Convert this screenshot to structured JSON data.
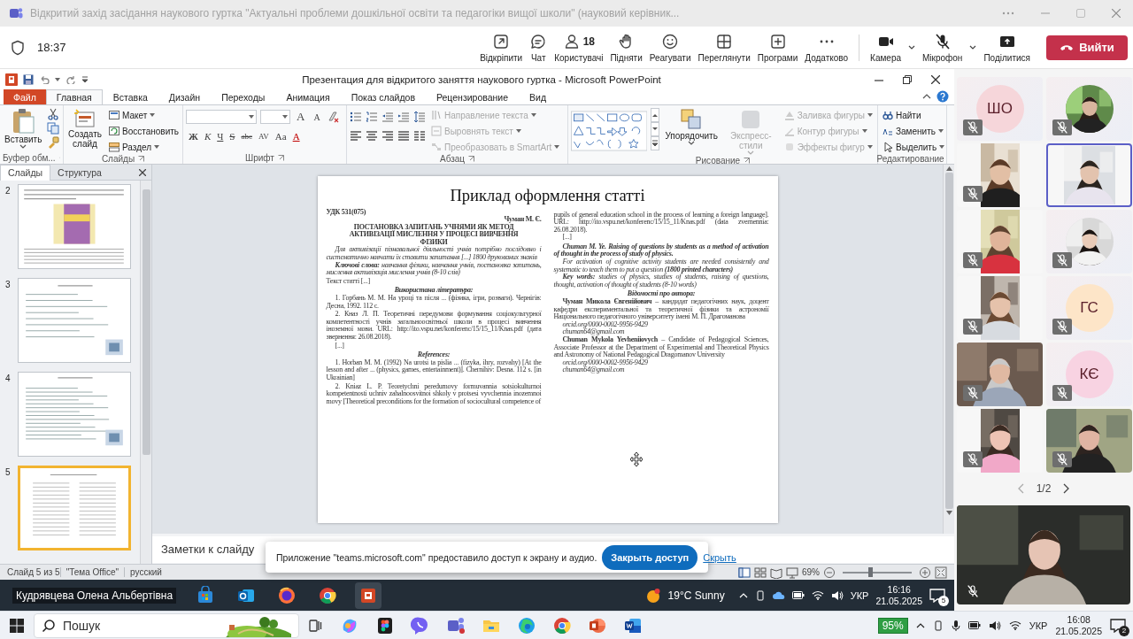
{
  "teams_window": {
    "title": "Відкритий захід засідання наукового гуртка \"Актуальні проблеми дошкільної освіти та педагогіки вищої школи\" (науковий керівник..."
  },
  "meeting_bar": {
    "elapsed": "18:37",
    "participants_count": "18",
    "buttons": [
      {
        "label": "Відкріпити"
      },
      {
        "label": "Чат"
      },
      {
        "label": "Користувачі"
      },
      {
        "label": "Підняти"
      },
      {
        "label": "Реагувати"
      },
      {
        "label": "Переглянути"
      },
      {
        "label": "Програми"
      },
      {
        "label": "Додатково"
      }
    ],
    "devices": [
      {
        "label": "Камера",
        "on": true
      },
      {
        "label": "Мікрофон",
        "on": false
      }
    ],
    "share": "Поділитися",
    "leave": "Вийти"
  },
  "powerpoint": {
    "title": "Презентация для відкритого заняття наукового гуртка  -  Microsoft PowerPoint",
    "file_tab": "Файл",
    "tabs": [
      {
        "label": "Главная",
        "selected": true
      },
      {
        "label": "Вставка",
        "selected": false
      },
      {
        "label": "Дизайн",
        "selected": false
      },
      {
        "label": "Переходы",
        "selected": false
      },
      {
        "label": "Анимация",
        "selected": false
      },
      {
        "label": "Показ слайдов",
        "selected": false
      },
      {
        "label": "Рецензирование",
        "selected": false
      },
      {
        "label": "Вид",
        "selected": false
      }
    ],
    "ribbon": {
      "clipboard": {
        "paste": "Вставить",
        "label": "Буфер обм..."
      },
      "slides": {
        "new_slide": "Создать слайд",
        "items": [
          "Макет",
          "Восстановить",
          "Раздел"
        ],
        "label": "Слайды"
      },
      "font": {
        "grow": "A",
        "shrink": "A",
        "format_buttons": [
          "Ж",
          "К",
          "Ч",
          "S",
          "abc",
          "AV",
          "Aa",
          "A"
        ],
        "label": "Шрифт"
      },
      "paragraph": {
        "commands": [
          {
            "label": "Направление текста",
            "disabled": true
          },
          {
            "label": "Выровнять текст",
            "disabled": true
          },
          {
            "label": "Преобразовать в SmartArt",
            "disabled": true
          }
        ],
        "label": "Абзац"
      },
      "drawing": {
        "arrange": "Упорядочить",
        "quick_styles": {
          "label": "Экспресс-стили",
          "disabled": true
        },
        "commands": [
          {
            "label": "Заливка фигуры",
            "disabled": true
          },
          {
            "label": "Контур фигуры",
            "disabled": true
          },
          {
            "label": "Эффекты фигур",
            "disabled": true
          }
        ],
        "label": "Рисование"
      },
      "editing": {
        "commands": [
          {
            "label": "Найти",
            "disabled": false
          },
          {
            "label": "Заменить",
            "disabled": false
          },
          {
            "label": "Выделить",
            "disabled": false
          }
        ],
        "label": "Редактирование"
      }
    },
    "panel": {
      "tabs": [
        {
          "label": "Слайды",
          "selected": true
        },
        {
          "label": "Структура",
          "selected": false
        }
      ],
      "thumbnails": [
        {
          "number": "2",
          "selected": false
        },
        {
          "number": "3",
          "selected": false
        },
        {
          "number": "4",
          "selected": false
        },
        {
          "number": "5",
          "selected": true
        }
      ]
    },
    "slide": {
      "title": "Приклад оформлення статті",
      "columns": [
        [
          {
            "kind": "udc",
            "text": "УДК 531(075)"
          },
          {
            "kind": "author",
            "text": "Чуман М. Є."
          },
          {
            "kind": "title",
            "text": "ПОСТАНОВКА ЗАПИТАНЬ УЧНЯМИ ЯК МЕТОД АКТИВІЗАЦІЇ МИСЛЕННЯ У ПРОЦЕСІ ВИВЧЕННЯ ФІЗИКИ"
          },
          {
            "kind": "abstract",
            "text": "Для активізації пізнавальної діяльності учнів потрібно послідовно і систематично навчати їх ставити запитання [...] 1800 друкованих знаків"
          },
          {
            "kind": "abstract",
            "text": "**Ключові слова:** навчання фізики, навчання учнів, постановка запитань, мислення активізація мислення учнів (8-10 слів)"
          },
          {
            "kind": "text",
            "text": "Текст статті [...]"
          },
          {
            "kind": "heading",
            "text": "Використана література:"
          },
          {
            "kind": "ref",
            "text": "1. Горбань М. М. На уроці та після ... (фізика, ігри, розваги). Чернігів: Десна, 1992. 112 с."
          },
          {
            "kind": "ref",
            "text": "2. Кназ Л. П. Теоретичні передумови формування соціокультурної компетентності учнів загальноосвітньої школи в процесі вивчення іноземної мови. URL: http://ito.vspu.net/konferenc/15/15_11/Knas.pdf (дата звернення: 26.08.2018)."
          },
          {
            "kind": "ref",
            "text": "[...]"
          },
          {
            "kind": "heading",
            "text": "References:"
          },
          {
            "kind": "ref",
            "text": "1. Horban M. M. (1992) Na urotsi ta pislia ... (fizyka, ihry, rozvahy) [At the lesson and after ... (physics, games, entertainment)]. Chernihiv: Desna. 112 s. [in Ukrainian]"
          },
          {
            "kind": "ref",
            "text": "2. Kniaz L. P. Teoretychni peredumovy formuvannia sotsiokulturnoi kompetentnosti uchniv zahalnoosvitnoi shkoly v protsesi vyvchennia inozemnoi movy [Theoretical preconditions for the formation of sociocultural competence of"
          }
        ],
        [
          {
            "kind": "text",
            "text": "pupils of general education school in the process of learning a foreign language]. URL: http://ito.vspu.net/konferenc/15/15_11/Knas.pdf (data zvernennia: 26.08.2018)."
          },
          {
            "kind": "ref",
            "text": "[...]"
          },
          {
            "kind": "abstract-title",
            "text": "Chuman M. Ye. Raising of questions by students as a method of activation of thought in the process of study of physics."
          },
          {
            "kind": "abstract",
            "text": "For activation of cognitive activity students are needed consistently and systematic to teach them to put a question **(1800 printed characters)**"
          },
          {
            "kind": "abstract",
            "text": "**Key words:** studies of physics, studies of students, raising of questions, thought, activation of thought of students (8-10 words)"
          },
          {
            "kind": "heading",
            "text": "Відомості про автора:"
          },
          {
            "kind": "bio",
            "text": "**Чуман Микола Євгенійович** – кандидат педагогічних наук, доцент кафедри експериментальної та теоретичної фізики та астрономії Національного педагогічного університету імені М. П. Драгоманова"
          },
          {
            "kind": "contact",
            "text": "orcid.org/0000-0002-9956-9429"
          },
          {
            "kind": "contact",
            "text": "chuman64@gmail.com"
          },
          {
            "kind": "bio",
            "text": "**Chuman Mykola Yevheniiovych** – Candidate of Pedagogical Sciences, Associate Professor at the Department of Experimental and Theoretical Physics and Astronomy of National Pedagogical Dragomanov University"
          },
          {
            "kind": "contact",
            "text": "orcid.org/0000-0002-9956-9429"
          },
          {
            "kind": "contact",
            "text": "chuman64@gmail.com"
          }
        ]
      ]
    },
    "notes": {
      "placeholder": "Заметки к слайду"
    },
    "status_bar": {
      "slide": "Слайд 5 из 5",
      "theme": "\"Тема Office\"",
      "language": "русский",
      "zoom": "69%",
      "zoom_slider": {
        "level": 0.4
      }
    }
  },
  "share_banner": {
    "text": "Приложение \"teams.microsoft.com\" предоставило доступ к экрану и аудио.",
    "stop": "Закрыть доступ",
    "hide": "Скрыть"
  },
  "shared_taskbar": {
    "presenter": "Кудрявцева Олена Альбертівна",
    "weather": "19°C Sunny",
    "language": "УКР",
    "time": "16:16",
    "date": "21.05.2025",
    "notifications": "5"
  },
  "gallery": {
    "participants": [
      {
        "kind": "initials",
        "initials": "ШО",
        "color": "#f6d6da",
        "muted": true,
        "speaking": false
      },
      {
        "kind": "avatar",
        "muted": true,
        "speaking": false
      },
      {
        "kind": "video-portrait",
        "muted": true,
        "speaking": false
      },
      {
        "kind": "video-portrait",
        "muted": false,
        "speaking": true
      },
      {
        "kind": "video-portrait",
        "muted": true,
        "speaking": false
      },
      {
        "kind": "avatar",
        "muted": true,
        "speaking": false
      },
      {
        "kind": "video-portrait",
        "muted": true,
        "speaking": false
      },
      {
        "kind": "initials",
        "initials": "ГС",
        "color": "#fde5c8",
        "muted": true,
        "speaking": false
      },
      {
        "kind": "video",
        "muted": true,
        "speaking": false
      },
      {
        "kind": "initials",
        "initials": "КЄ",
        "color": "#f8d3e2",
        "muted": true,
        "speaking": false
      },
      {
        "kind": "video-portrait",
        "muted": true,
        "speaking": false
      },
      {
        "kind": "video",
        "muted": true,
        "speaking": false
      }
    ],
    "page": "1/2",
    "self": {
      "muted": true
    }
  },
  "taskbar": {
    "search": {
      "placeholder": "Пошук"
    },
    "battery": "95%",
    "language": "УКР",
    "time": "16:08",
    "date": "21.05.2025",
    "notifications": "2"
  }
}
